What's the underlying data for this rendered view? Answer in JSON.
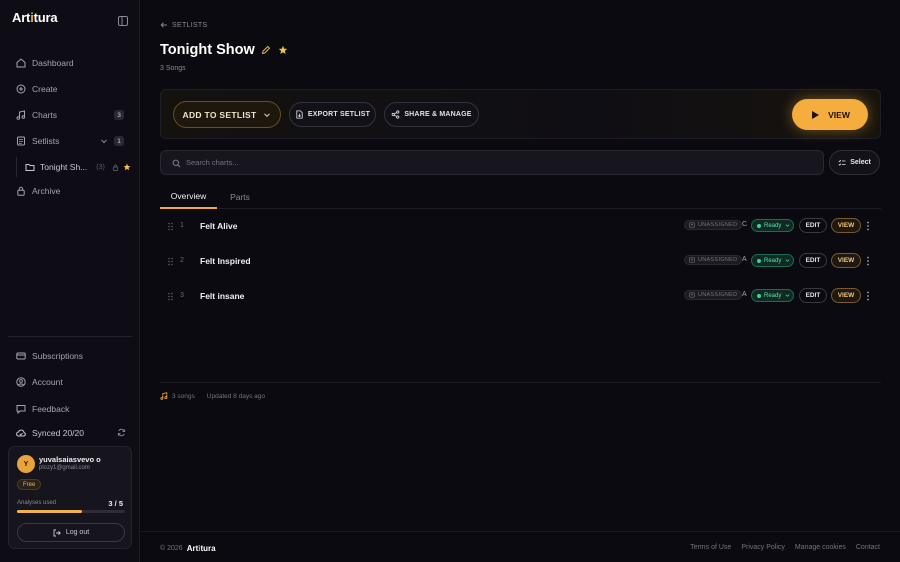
{
  "app": {
    "logo_prefix": "Art",
    "logo_highlight": "i",
    "logo_suffix": "tura"
  },
  "sidebar": {
    "nav": [
      {
        "label": "Dashboard",
        "icon": "home-icon"
      },
      {
        "label": "Create",
        "icon": "plus-circle-icon"
      },
      {
        "label": "Charts",
        "icon": "music-note-icon",
        "badge": "3"
      },
      {
        "label": "Setlists",
        "icon": "setlist-icon",
        "badge": "1"
      },
      {
        "label": "Archive",
        "icon": "lock-icon"
      }
    ],
    "sub_item": {
      "label": "Tonight Sh...",
      "count": "(3)"
    },
    "bottom": [
      {
        "label": "Subscriptions",
        "icon": "credit-card-icon"
      },
      {
        "label": "Account",
        "icon": "user-circle-icon"
      },
      {
        "label": "Feedback",
        "icon": "message-icon"
      }
    ],
    "sync_label": "Synced 20/20"
  },
  "user": {
    "initial": "Y",
    "name": "yuvalsaiasvevo o",
    "email": "plozy1@gmail.com",
    "plan": "Free",
    "usage_label": "Analyses used",
    "usage_value": "3 / 5",
    "usage_fraction": 0.6,
    "logout_label": "Log out"
  },
  "page": {
    "breadcrumb": "SETLISTS",
    "title": "Tonight Show",
    "subtitle": "3 Songs"
  },
  "toolbar": {
    "add_label": "ADD TO SETLIST",
    "export_label": "EXPORT SETLIST",
    "share_label": "SHARE & MANAGE",
    "view_label": "VIEW"
  },
  "search": {
    "placeholder": "Search charts...",
    "select_label": "Select"
  },
  "tabs": [
    "Overview",
    "Parts"
  ],
  "songs": [
    {
      "num": "1",
      "name": "Felt Alive",
      "assignment": "UNASSIGNED",
      "key": "C",
      "status": "Ready",
      "edit": "EDIT",
      "view": "VIEW"
    },
    {
      "num": "2",
      "name": "Felt Inspired",
      "assignment": "UNASSIGNED",
      "key": "A",
      "status": "Ready",
      "edit": "EDIT",
      "view": "VIEW"
    },
    {
      "num": "3",
      "name": "Felt insane",
      "assignment": "UNASSIGNED",
      "key": "A",
      "status": "Ready",
      "edit": "EDIT",
      "view": "VIEW"
    }
  ],
  "summary": {
    "songs": "3 songs",
    "updated": "Updated 8 days ago"
  },
  "footer": {
    "copyright": "© 2026",
    "links": [
      "Terms of Use",
      "Privacy Policy",
      "Manage cookies",
      "Contact"
    ]
  },
  "colors": {
    "accent": "#f5ad3e",
    "background": "#0b0a10",
    "ready": "#38d39c"
  }
}
